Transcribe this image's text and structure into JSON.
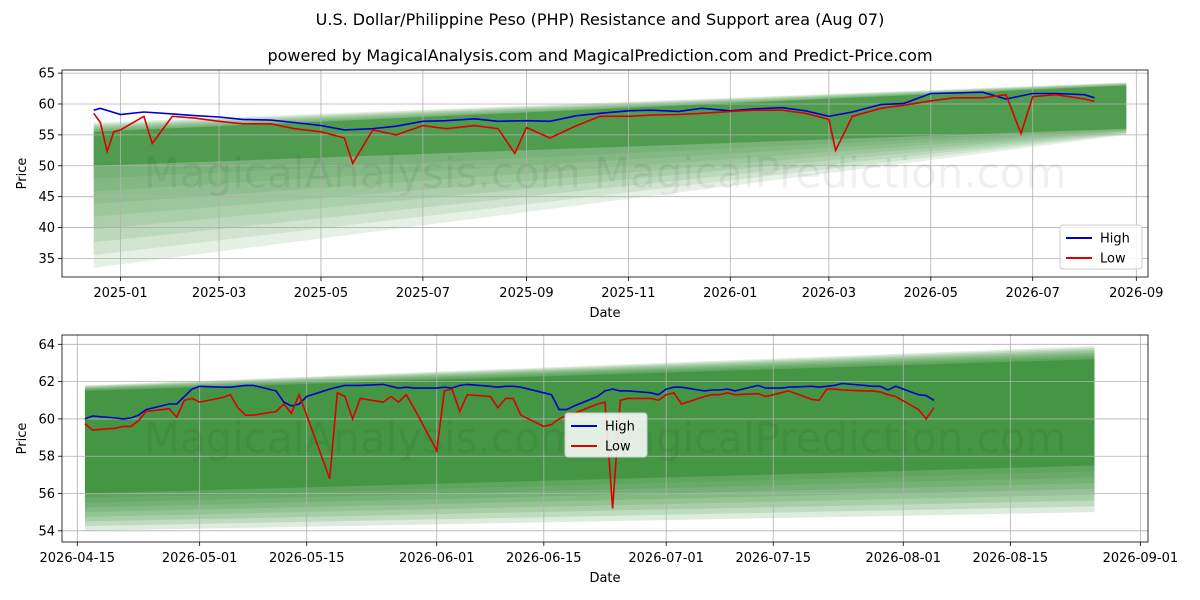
{
  "header": {
    "title": "U.S. Dollar/Philippine Peso (PHP) Resistance and Support area (Aug 07)",
    "subtitle": "powered by MagicalAnalysis.com and MagicalPrediction.com and Predict-Price.com"
  },
  "watermark": "MagicalAnalysis.com   MagicalPrediction.com",
  "colors": {
    "high": "#0000cc",
    "low": "#dd0000",
    "band": "#2e8b2e"
  },
  "chart_data": [
    {
      "type": "line",
      "xlabel": "Date",
      "ylabel": "Price",
      "xlim": [
        "2024-11-27",
        "2026-09-08"
      ],
      "ylim": [
        32,
        65.5
      ],
      "x_ticks": [
        "2025-01",
        "2025-03",
        "2025-05",
        "2025-07",
        "2025-09",
        "2025-11",
        "2026-01",
        "2026-03",
        "2026-05",
        "2026-07",
        "2026-09"
      ],
      "x_tick_dates": [
        "2025-01-01",
        "2025-03-01",
        "2025-05-01",
        "2025-07-01",
        "2025-09-01",
        "2025-11-01",
        "2026-01-01",
        "2026-03-01",
        "2026-05-01",
        "2026-07-01",
        "2026-09-01"
      ],
      "y_ticks": [
        35,
        40,
        45,
        50,
        55,
        60,
        65
      ],
      "grid": true,
      "legend_position": "bottom-right",
      "band": {
        "x": [
          "2024-12-16",
          "2026-08-26"
        ],
        "outer_upper": [
          57.0,
          63.5
        ],
        "outer_lower": [
          33.5,
          55.0
        ],
        "core_upper": [
          55.5,
          63.0
        ],
        "core_lower": [
          50.0,
          56.0
        ]
      },
      "series": [
        {
          "name": "High",
          "x": [
            "2024-12-16",
            "2024-12-20",
            "2025-01-01",
            "2025-01-15",
            "2025-02-01",
            "2025-02-15",
            "2025-03-01",
            "2025-03-15",
            "2025-04-01",
            "2025-04-15",
            "2025-05-01",
            "2025-05-15",
            "2025-06-01",
            "2025-06-15",
            "2025-07-01",
            "2025-07-15",
            "2025-08-01",
            "2025-08-15",
            "2025-09-01",
            "2025-09-15",
            "2025-10-01",
            "2025-10-15",
            "2025-11-01",
            "2025-11-15",
            "2025-12-01",
            "2025-12-15",
            "2026-01-01",
            "2026-01-15",
            "2026-02-01",
            "2026-02-15",
            "2026-03-01",
            "2026-03-15",
            "2026-04-01",
            "2026-04-15",
            "2026-05-01",
            "2026-05-15",
            "2026-06-01",
            "2026-06-15",
            "2026-07-01",
            "2026-07-15",
            "2026-08-01",
            "2026-08-07"
          ],
          "values": [
            59.0,
            59.3,
            58.3,
            58.7,
            58.4,
            58.1,
            57.9,
            57.5,
            57.4,
            57.0,
            56.5,
            55.8,
            56.0,
            56.4,
            57.2,
            57.3,
            57.6,
            57.2,
            57.3,
            57.2,
            58.1,
            58.5,
            58.9,
            59.0,
            58.8,
            59.3,
            58.9,
            59.2,
            59.4,
            58.9,
            58.0,
            58.7,
            59.9,
            60.1,
            61.7,
            61.8,
            61.9,
            60.8,
            61.7,
            61.7,
            61.5,
            61.0
          ]
        },
        {
          "name": "Low",
          "x": [
            "2024-12-16",
            "2024-12-20",
            "2024-12-24",
            "2024-12-28",
            "2025-01-01",
            "2025-01-15",
            "2025-01-20",
            "2025-02-01",
            "2025-02-15",
            "2025-03-01",
            "2025-03-15",
            "2025-04-01",
            "2025-04-15",
            "2025-05-01",
            "2025-05-15",
            "2025-05-20",
            "2025-06-01",
            "2025-06-15",
            "2025-07-01",
            "2025-07-15",
            "2025-08-01",
            "2025-08-15",
            "2025-08-25",
            "2025-09-01",
            "2025-09-15",
            "2025-10-01",
            "2025-10-15",
            "2025-11-01",
            "2025-11-15",
            "2025-12-01",
            "2025-12-15",
            "2026-01-01",
            "2026-01-15",
            "2026-02-01",
            "2026-02-15",
            "2026-03-01",
            "2026-03-05",
            "2026-03-15",
            "2026-04-01",
            "2026-04-15",
            "2026-05-01",
            "2026-05-15",
            "2026-06-01",
            "2026-06-15",
            "2026-06-24",
            "2026-07-01",
            "2026-07-15",
            "2026-08-01",
            "2026-08-07"
          ],
          "values": [
            58.5,
            57.0,
            52.3,
            55.5,
            55.8,
            58.0,
            53.6,
            58.0,
            57.7,
            57.2,
            56.8,
            56.8,
            56.0,
            55.5,
            54.5,
            50.4,
            55.8,
            55.0,
            56.5,
            56.0,
            56.5,
            56.0,
            52.0,
            56.2,
            54.5,
            56.5,
            58.0,
            58.0,
            58.2,
            58.3,
            58.5,
            58.8,
            59.0,
            59.0,
            58.5,
            57.5,
            52.5,
            58.0,
            59.3,
            59.8,
            60.5,
            61.0,
            61.0,
            61.5,
            55.2,
            61.2,
            61.5,
            60.8,
            60.4
          ]
        }
      ]
    },
    {
      "type": "line",
      "xlabel": "Date",
      "ylabel": "Price",
      "xlim": [
        "2026-04-13",
        "2026-09-02"
      ],
      "ylim": [
        53.4,
        64.5
      ],
      "x_ticks": [
        "2026-04-15",
        "2026-05-01",
        "2026-05-15",
        "2026-06-01",
        "2026-06-15",
        "2026-07-01",
        "2026-07-15",
        "2026-08-01",
        "2026-08-15",
        "2026-09-01"
      ],
      "y_ticks": [
        54,
        56,
        58,
        60,
        62,
        64
      ],
      "grid": true,
      "legend_position": "center",
      "band": {
        "x": [
          "2026-04-16",
          "2026-08-26"
        ],
        "outer_upper": [
          61.8,
          63.9
        ],
        "outer_lower": [
          54.0,
          55.0
        ],
        "core_upper": [
          61.5,
          63.2
        ],
        "core_lower": [
          56.0,
          57.5
        ]
      },
      "series": [
        {
          "name": "High",
          "x": [
            "2026-04-16",
            "2026-04-17",
            "2026-04-20",
            "2026-04-21",
            "2026-04-22",
            "2026-04-23",
            "2026-04-24",
            "2026-04-27",
            "2026-04-28",
            "2026-04-29",
            "2026-04-30",
            "2026-05-01",
            "2026-05-04",
            "2026-05-05",
            "2026-05-06",
            "2026-05-07",
            "2026-05-08",
            "2026-05-11",
            "2026-05-12",
            "2026-05-13",
            "2026-05-14",
            "2026-05-15",
            "2026-05-18",
            "2026-05-19",
            "2026-05-20",
            "2026-05-21",
            "2026-05-22",
            "2026-05-25",
            "2026-05-26",
            "2026-05-27",
            "2026-05-28",
            "2026-05-29",
            "2026-06-01",
            "2026-06-02",
            "2026-06-03",
            "2026-06-04",
            "2026-06-05",
            "2026-06-08",
            "2026-06-09",
            "2026-06-10",
            "2026-06-11",
            "2026-06-12",
            "2026-06-15",
            "2026-06-16",
            "2026-06-17",
            "2026-06-18",
            "2026-06-19",
            "2026-06-22",
            "2026-06-23",
            "2026-06-24",
            "2026-06-25",
            "2026-06-26",
            "2026-06-29",
            "2026-06-30",
            "2026-07-01",
            "2026-07-02",
            "2026-07-03",
            "2026-07-06",
            "2026-07-07",
            "2026-07-08",
            "2026-07-09",
            "2026-07-10",
            "2026-07-13",
            "2026-07-14",
            "2026-07-15",
            "2026-07-16",
            "2026-07-17",
            "2026-07-20",
            "2026-07-21",
            "2026-07-22",
            "2026-07-23",
            "2026-07-24",
            "2026-07-27",
            "2026-07-28",
            "2026-07-29",
            "2026-07-30",
            "2026-07-31",
            "2026-08-03",
            "2026-08-04",
            "2026-08-05"
          ],
          "values": [
            60.0,
            60.15,
            60.05,
            60.0,
            60.05,
            60.2,
            60.5,
            60.8,
            60.8,
            61.2,
            61.6,
            61.75,
            61.7,
            61.7,
            61.75,
            61.8,
            61.8,
            61.5,
            60.9,
            60.7,
            60.8,
            61.2,
            61.6,
            61.7,
            61.8,
            61.8,
            61.8,
            61.85,
            61.75,
            61.65,
            61.7,
            61.65,
            61.65,
            61.7,
            61.65,
            61.8,
            61.85,
            61.75,
            61.7,
            61.75,
            61.75,
            61.7,
            61.4,
            61.3,
            60.5,
            60.5,
            60.7,
            61.2,
            61.5,
            61.6,
            61.5,
            61.5,
            61.4,
            61.3,
            61.6,
            61.7,
            61.7,
            61.5,
            61.55,
            61.55,
            61.6,
            61.5,
            61.8,
            61.65,
            61.65,
            61.65,
            61.7,
            61.75,
            61.7,
            61.75,
            61.8,
            61.9,
            61.8,
            61.75,
            61.75,
            61.55,
            61.75,
            61.3,
            61.25,
            61.0
          ]
        },
        {
          "name": "Low",
          "x": [
            "2026-04-16",
            "2026-04-17",
            "2026-04-20",
            "2026-04-21",
            "2026-04-22",
            "2026-04-23",
            "2026-04-24",
            "2026-04-27",
            "2026-04-28",
            "2026-04-29",
            "2026-04-30",
            "2026-05-01",
            "2026-05-04",
            "2026-05-05",
            "2026-05-06",
            "2026-05-07",
            "2026-05-08",
            "2026-05-11",
            "2026-05-12",
            "2026-05-13",
            "2026-05-14",
            "2026-05-15",
            "2026-05-18",
            "2026-05-19",
            "2026-05-20",
            "2026-05-21",
            "2026-05-22",
            "2026-05-25",
            "2026-05-26",
            "2026-05-27",
            "2026-05-28",
            "2026-05-29",
            "2026-06-01",
            "2026-06-02",
            "2026-06-03",
            "2026-06-04",
            "2026-06-05",
            "2026-06-08",
            "2026-06-09",
            "2026-06-10",
            "2026-06-11",
            "2026-06-12",
            "2026-06-15",
            "2026-06-16",
            "2026-06-17",
            "2026-06-18",
            "2026-06-19",
            "2026-06-22",
            "2026-06-23",
            "2026-06-24",
            "2026-06-25",
            "2026-06-26",
            "2026-06-29",
            "2026-06-30",
            "2026-07-01",
            "2026-07-02",
            "2026-07-03",
            "2026-07-06",
            "2026-07-07",
            "2026-07-08",
            "2026-07-09",
            "2026-07-10",
            "2026-07-13",
            "2026-07-14",
            "2026-07-15",
            "2026-07-16",
            "2026-07-17",
            "2026-07-20",
            "2026-07-21",
            "2026-07-22",
            "2026-07-23",
            "2026-07-24",
            "2026-07-27",
            "2026-07-28",
            "2026-07-29",
            "2026-07-30",
            "2026-07-31",
            "2026-08-03",
            "2026-08-04",
            "2026-08-05"
          ],
          "values": [
            59.75,
            59.4,
            59.5,
            59.6,
            59.6,
            59.9,
            60.4,
            60.55,
            60.1,
            61.0,
            61.1,
            60.9,
            61.15,
            61.3,
            60.6,
            60.2,
            60.2,
            60.4,
            60.8,
            60.3,
            61.3,
            60.2,
            56.8,
            61.4,
            61.2,
            60.0,
            61.1,
            60.9,
            61.2,
            60.9,
            61.3,
            60.6,
            58.3,
            61.5,
            61.6,
            60.4,
            61.3,
            61.2,
            60.6,
            61.1,
            61.1,
            60.2,
            59.6,
            59.7,
            60.0,
            60.2,
            60.3,
            60.8,
            60.9,
            55.2,
            61.0,
            61.1,
            61.1,
            61.0,
            61.3,
            61.4,
            60.8,
            61.2,
            61.3,
            61.3,
            61.4,
            61.3,
            61.35,
            61.2,
            61.3,
            61.4,
            61.5,
            61.05,
            61.0,
            61.6,
            61.6,
            61.55,
            61.5,
            61.5,
            61.45,
            61.3,
            61.2,
            60.5,
            60.0,
            60.6
          ]
        }
      ]
    }
  ]
}
